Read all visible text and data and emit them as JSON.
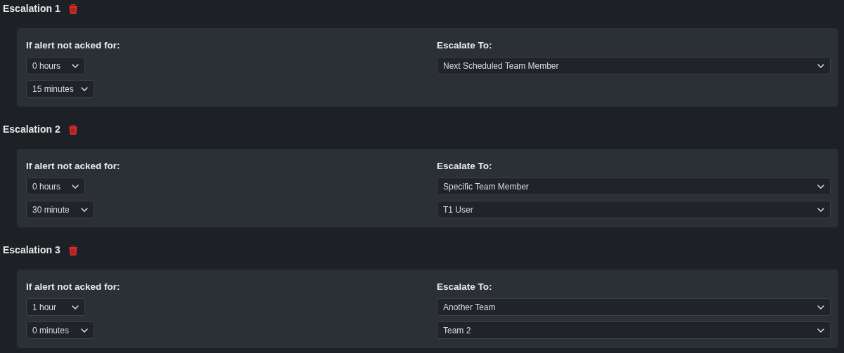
{
  "escalations": [
    {
      "title": "Escalation 1",
      "wait_label": "If alert not acked for:",
      "hours": "0 hours",
      "minutes": "15 minutes",
      "target_label": "Escalate To:",
      "targets": [
        "Next Scheduled Team Member"
      ]
    },
    {
      "title": "Escalation 2",
      "wait_label": "If alert not acked for:",
      "hours": "0 hours",
      "minutes": "30 minute",
      "target_label": "Escalate To:",
      "targets": [
        "Specific Team Member",
        "T1 User"
      ]
    },
    {
      "title": "Escalation 3",
      "wait_label": "If alert not acked for:",
      "hours": "1 hour",
      "minutes": "0 minutes",
      "target_label": "Escalate To:",
      "targets": [
        "Another Team",
        "Team 2"
      ]
    }
  ]
}
